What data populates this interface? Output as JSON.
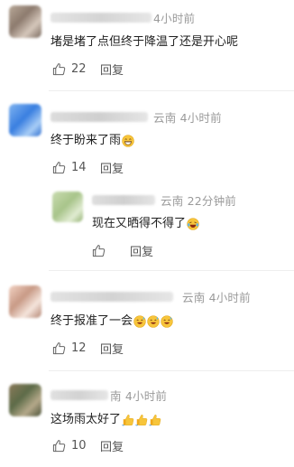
{
  "comments": [
    {
      "meta": "4小时前",
      "text": "堵是堵了点但终于降温了还是开心呢",
      "likes": "22",
      "reply": "回复"
    },
    {
      "meta": "云南 4小时前",
      "text": "终于盼来了雨",
      "likes": "14",
      "reply": "回复",
      "reply_item": {
        "meta": "云南 22分钟前",
        "text": "现在又晒得不得了",
        "reply": "回复"
      }
    },
    {
      "meta": "云南 4小时前",
      "text": "终于报准了一会",
      "likes": "12",
      "reply": "回复"
    },
    {
      "meta": "南 4小时前",
      "text": "这场雨太好了",
      "likes": "10",
      "reply": "回复"
    }
  ],
  "icons": {
    "like": "thumbs-up-icon",
    "grin": "grin-emoji-icon",
    "laugh": "laugh-tears-emoji-icon",
    "sweat": "sweat-smile-emoji-icon",
    "thumb": "thumbs-up-emoji-icon"
  },
  "colors": {
    "meta": "#9a9a9a",
    "text": "#1f1f1f",
    "action": "#555555"
  }
}
